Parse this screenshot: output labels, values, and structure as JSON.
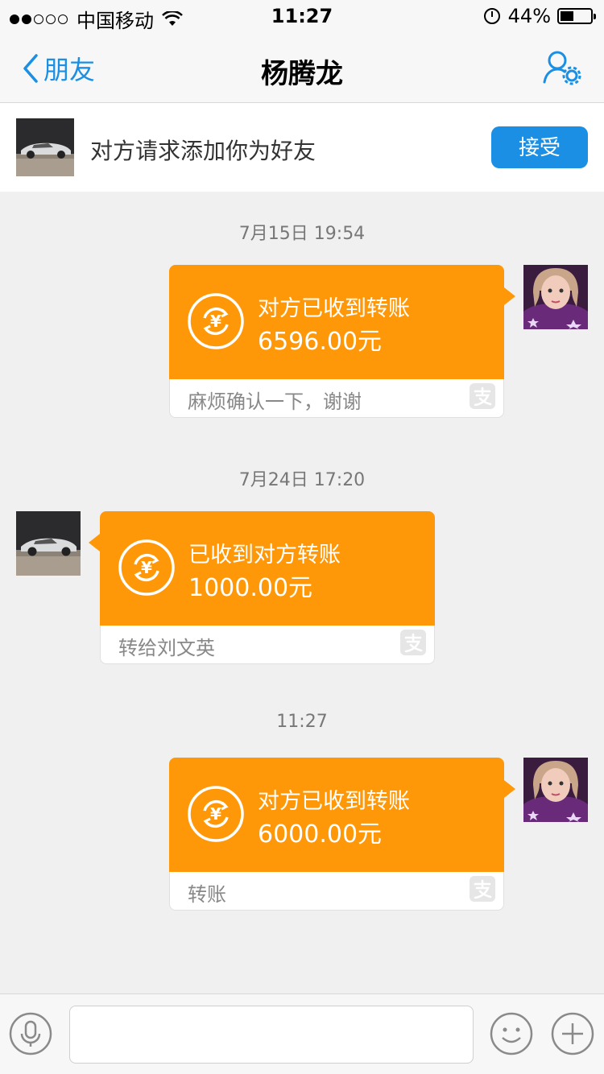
{
  "status_bar": {
    "carrier": "中国移动",
    "time": "11:27",
    "battery_text": "44%",
    "battery_level": 0.44,
    "signal_bars_filled": 2,
    "signal_bars_total": 5
  },
  "nav": {
    "back_label": "朋友",
    "title": "杨腾龙"
  },
  "friend_request": {
    "text": "对方请求添加你为好友",
    "accept_label": "接受"
  },
  "messages": [
    {
      "time": "7月15日 19:54",
      "side": "right",
      "status": "对方已收到转账",
      "amount": "6596.00元",
      "note": "麻烦确认一下，谢谢"
    },
    {
      "time": "7月24日 17:20",
      "side": "left",
      "status": "已收到对方转账",
      "amount": "1000.00元",
      "note": "转给刘文英"
    },
    {
      "time": "11:27",
      "side": "right",
      "status": "对方已收到转账",
      "amount": "6000.00元",
      "note": "转账"
    }
  ],
  "colors": {
    "accent_blue": "#1a8fe3",
    "transfer_orange": "#ff9808"
  },
  "icons": {
    "back": "chevron-left-icon",
    "settings": "user-settings-icon",
    "transfer": "yuan-transfer-icon",
    "brand": "alipay-icon",
    "voice": "microphone-icon",
    "emoji": "smiley-icon",
    "more": "plus-icon"
  }
}
